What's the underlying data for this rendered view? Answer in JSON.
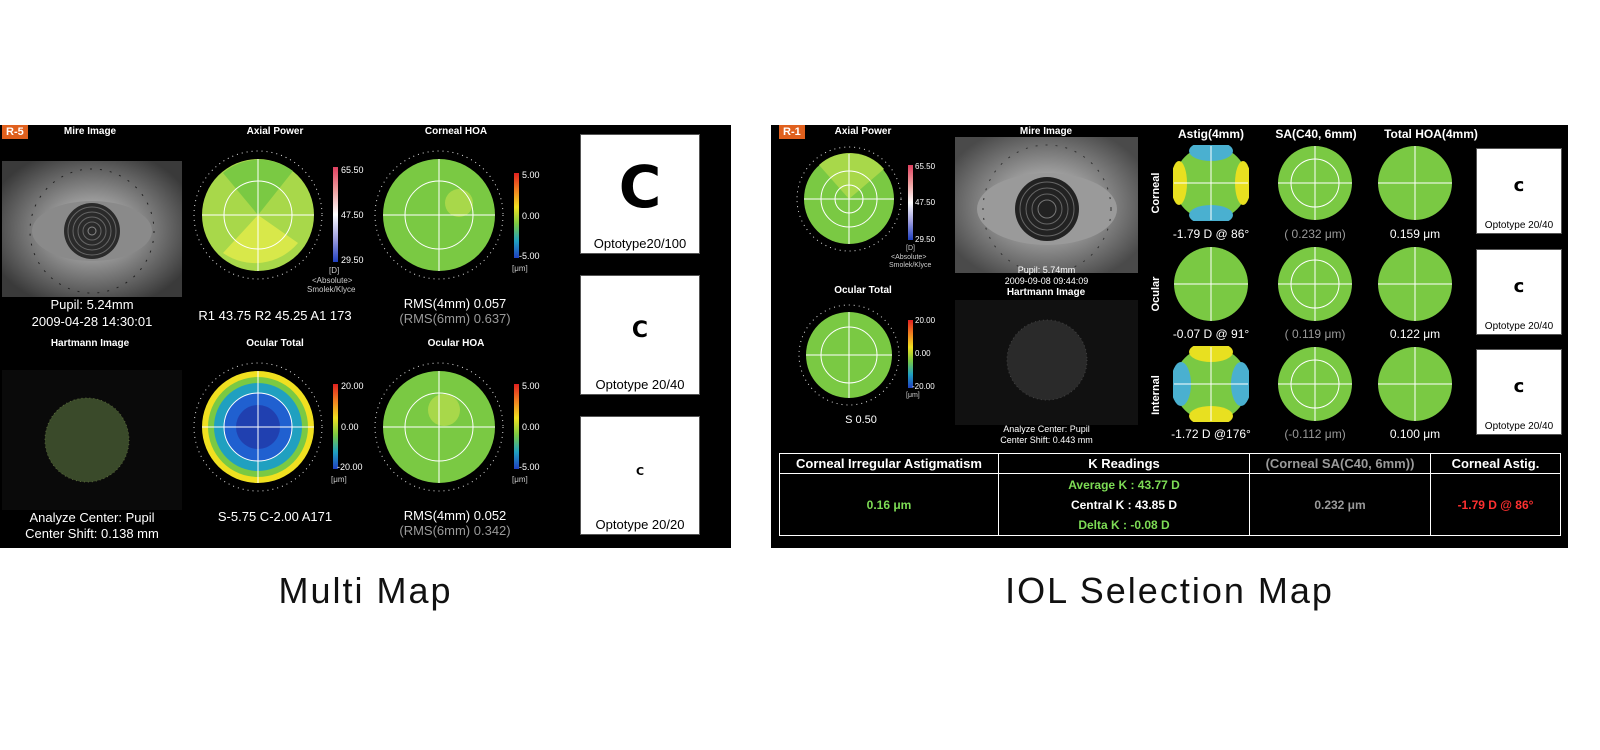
{
  "captions": {
    "left": "Multi Map",
    "right": "IOL Selection Map"
  },
  "multi": {
    "tag": "R-5",
    "mire_title": "Mire Image",
    "axial_title": "Axial Power",
    "corneal_hoa_title": "Corneal HOA",
    "hartmann_title": "Hartmann Image",
    "ocular_total_title": "Ocular Total",
    "ocular_hoa_title": "Ocular HOA",
    "pupil": "Pupil: 5.24mm",
    "datetime": "2009-04-28 14:30:01",
    "axial_readout": "R1 43.75 R2 45.25 A1 173",
    "corneal_rms4": "RMS(4mm)  0.057",
    "corneal_rms6": "(RMS(6mm)  0.637)",
    "analyze_center": "Analyze Center: Pupil",
    "center_shift": "Center Shift:  0.138 mm",
    "ocular_total_readout": "S-5.75 C-2.00 A171",
    "ocular_rms4": "RMS(4mm)  0.052",
    "ocular_rms6": "(RMS(6mm)  0.342)",
    "axial_scale": [
      "65.50",
      "47.50",
      "29.50"
    ],
    "axial_unit": "[D]",
    "axial_note1": "<Absolute>",
    "axial_note2": "Smolek/Klyce",
    "hoa_scale": [
      "5.00",
      "0.00",
      "-5.00"
    ],
    "hoa_unit": "[μm]",
    "total_scale": [
      "20.00",
      "0.00",
      "-20.00"
    ],
    "total_unit": "[μm]",
    "optotypes": [
      "Optotype20/100",
      "Optotype 20/40",
      "Optotype 20/20"
    ],
    "optotype_glyph": "C"
  },
  "iol": {
    "tag": "R-1",
    "axial_title": "Axial Power",
    "mire_title": "Mire Image",
    "ocular_total_title": "Ocular Total",
    "hartmann_title": "Hartmann Image",
    "axial_scale": [
      "65.50",
      "47.50",
      "29.50"
    ],
    "axial_unit": "[D]",
    "axial_note1": "<Absolute>",
    "axial_note2": "Smolek/Klyce",
    "total_scale": [
      "20.00",
      "0.00",
      "-20.00"
    ],
    "total_unit": "[μm]",
    "ocular_s": "S 0.50",
    "pupil": "Pupil: 5.74mm",
    "datetime": "2009-09-08 09:44:09",
    "analyze_center": "Analyze Center: Pupil",
    "center_shift": "Center Shift:  0.443 mm",
    "col_headers": [
      "Astig(4mm)",
      "SA(C40, 6mm)",
      "Total HOA(4mm)"
    ],
    "row_labels": [
      "Corneal",
      "Ocular",
      "Internal"
    ],
    "values": [
      [
        "-1.79 D @ 86°",
        "( 0.232 μm)",
        "0.159 μm"
      ],
      [
        "-0.07 D @ 91°",
        "( 0.119 μm)",
        "0.122 μm"
      ],
      [
        "-1.72 D @176°",
        "(-0.112 μm)",
        "0.100 μm"
      ]
    ],
    "optotypes": [
      "Optotype 20/40",
      "Optotype 20/40",
      "Optotype 20/40"
    ],
    "optotype_glyph": "c",
    "table": {
      "headers": [
        "Corneal Irregular Astigmatism",
        "K Readings",
        "(Corneal SA(C40, 6mm))",
        "Corneal Astig."
      ],
      "irregular": "0.16 μm",
      "average_k": "Average K : 43.77 D",
      "central_k": "Central K : 43.85 D",
      "delta_k": "Delta K : -0.08 D",
      "corneal_sa": "0.232 μm",
      "corneal_astig": "-1.79 D @ 86°"
    }
  }
}
